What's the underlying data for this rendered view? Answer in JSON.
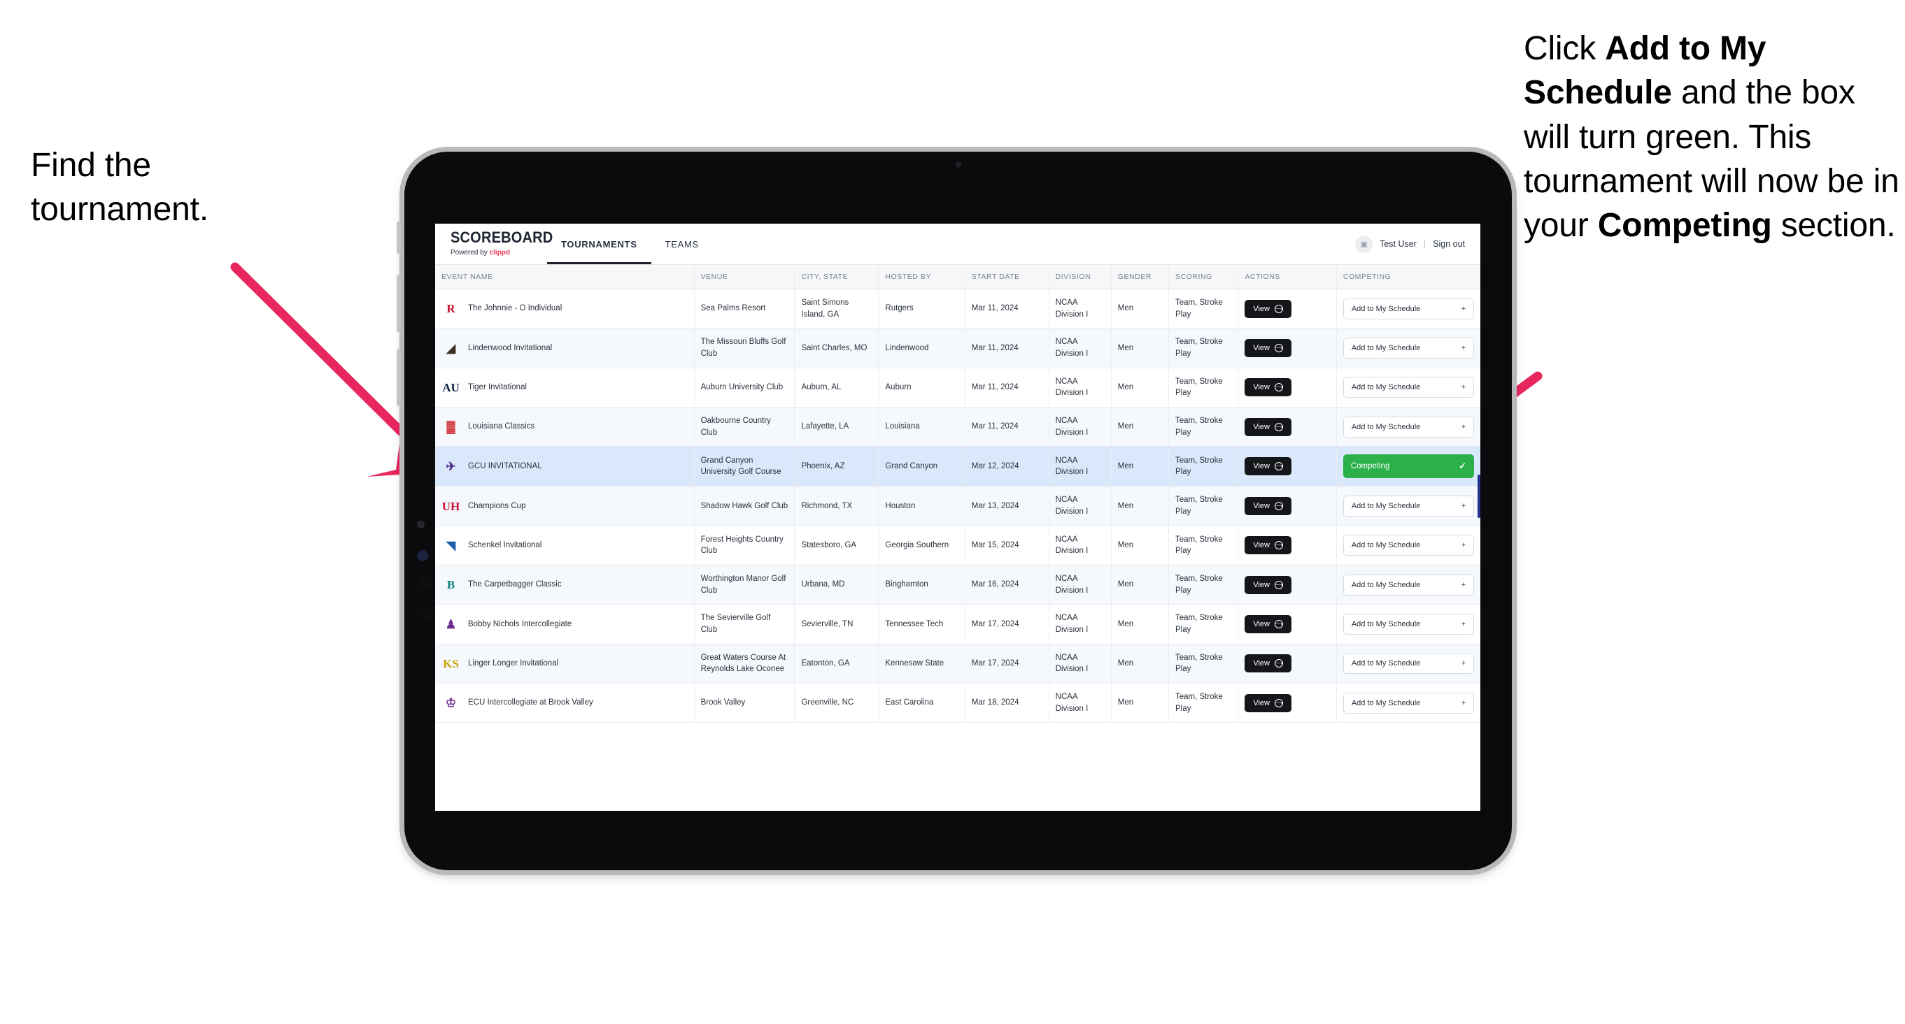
{
  "annotations": {
    "left": "Find the tournament.",
    "right_parts": [
      {
        "text": "Click ",
        "bold": false
      },
      {
        "text": "Add to My Schedule",
        "bold": true
      },
      {
        "text": " and the box will turn green. This tournament will now be in your ",
        "bold": false
      },
      {
        "text": "Competing",
        "bold": true
      },
      {
        "text": " section.",
        "bold": false
      }
    ],
    "arrow_color": "#e8275f"
  },
  "app": {
    "brand": {
      "title": "SCOREBOARD",
      "powered_prefix": "Powered by ",
      "powered_name": "clippd"
    },
    "nav_tabs": [
      {
        "label": "TOURNAMENTS",
        "active": true
      },
      {
        "label": "TEAMS",
        "active": false
      }
    ],
    "header_right": {
      "avatar_icon": "user-avatar-icon",
      "user_name": "Test User",
      "separator": "|",
      "sign_out": "Sign out"
    }
  },
  "table": {
    "columns": [
      "EVENT NAME",
      "VENUE",
      "CITY, STATE",
      "HOSTED BY",
      "START DATE",
      "DIVISION",
      "GENDER",
      "SCORING",
      "ACTIONS",
      "COMPETING"
    ],
    "action_label": "View",
    "add_label": "Add to My Schedule",
    "add_icon": "plus-icon",
    "competing_label": "Competing",
    "competing_icon": "check-icon",
    "competing_color": "#2bb04a",
    "rows": [
      {
        "logo": "R",
        "logo_color": "#c8102e",
        "logo_bg": "transparent",
        "event": "The Johnnie - O Individual",
        "venue": "Sea Palms Resort",
        "city": "Saint Simons Island, GA",
        "host": "Rutgers",
        "date": "Mar 11, 2024",
        "division": "NCAA Division I",
        "gender": "Men",
        "scoring": "Team, Stroke Play",
        "competing": false
      },
      {
        "logo": "◢",
        "logo_color": "#3b3226",
        "logo_bg": "transparent",
        "event": "Lindenwood Invitational",
        "venue": "The Missouri Bluffs Golf Club",
        "city": "Saint Charles, MO",
        "host": "Lindenwood",
        "date": "Mar 11, 2024",
        "division": "NCAA Division I",
        "gender": "Men",
        "scoring": "Team, Stroke Play",
        "competing": false
      },
      {
        "logo": "AU",
        "logo_color": "#0c2340",
        "logo_bg": "transparent",
        "event": "Tiger Invitational",
        "venue": "Auburn University Club",
        "city": "Auburn, AL",
        "host": "Auburn",
        "date": "Mar 11, 2024",
        "division": "NCAA Division I",
        "gender": "Men",
        "scoring": "Team, Stroke Play",
        "competing": false
      },
      {
        "logo": "▓",
        "logo_color": "#ce181e",
        "logo_bg": "transparent",
        "event": "Louisiana Classics",
        "venue": "Oakbourne Country Club",
        "city": "Lafayette, LA",
        "host": "Louisiana",
        "date": "Mar 11, 2024",
        "division": "NCAA Division I",
        "gender": "Men",
        "scoring": "Team, Stroke Play",
        "competing": false
      },
      {
        "logo": "✈",
        "logo_color": "#4f2d8f",
        "logo_bg": "transparent",
        "event": "GCU INVITATIONAL",
        "venue": "Grand Canyon University Golf Course",
        "city": "Phoenix, AZ",
        "host": "Grand Canyon",
        "date": "Mar 12, 2024",
        "division": "NCAA Division I",
        "gender": "Men",
        "scoring": "Team, Stroke Play",
        "competing": true,
        "highlight": true
      },
      {
        "logo": "UH",
        "logo_color": "#c8102e",
        "logo_bg": "transparent",
        "event": "Champions Cup",
        "venue": "Shadow Hawk Golf Club",
        "city": "Richmond, TX",
        "host": "Houston",
        "date": "Mar 13, 2024",
        "division": "NCAA Division I",
        "gender": "Men",
        "scoring": "Team, Stroke Play",
        "competing": false
      },
      {
        "logo": "◥",
        "logo_color": "#1e5fa8",
        "logo_bg": "transparent",
        "event": "Schenkel Invitational",
        "venue": "Forest Heights Country Club",
        "city": "Statesboro, GA",
        "host": "Georgia Southern",
        "date": "Mar 15, 2024",
        "division": "NCAA Division I",
        "gender": "Men",
        "scoring": "Team, Stroke Play",
        "competing": false
      },
      {
        "logo": "B",
        "logo_color": "#0f7f7f",
        "logo_bg": "transparent",
        "event": "The Carpetbagger Classic",
        "venue": "Worthington Manor Golf Club",
        "city": "Urbana, MD",
        "host": "Binghamton",
        "date": "Mar 16, 2024",
        "division": "NCAA Division I",
        "gender": "Men",
        "scoring": "Team, Stroke Play",
        "competing": false
      },
      {
        "logo": "♟",
        "logo_color": "#6b2d8f",
        "logo_bg": "transparent",
        "event": "Bobby Nichols Intercollegiate",
        "venue": "The Sevierville Golf Club",
        "city": "Sevierville, TN",
        "host": "Tennessee Tech",
        "date": "Mar 17, 2024",
        "division": "NCAA Division I",
        "gender": "Men",
        "scoring": "Team, Stroke Play",
        "competing": false
      },
      {
        "logo": "KS",
        "logo_color": "#c8a20a",
        "logo_bg": "transparent",
        "event": "Linger Longer Invitational",
        "venue": "Great Waters Course At Reynolds Lake Oconee",
        "city": "Eatonton, GA",
        "host": "Kennesaw State",
        "date": "Mar 17, 2024",
        "division": "NCAA Division I",
        "gender": "Men",
        "scoring": "Team, Stroke Play",
        "competing": false
      },
      {
        "logo": "♔",
        "logo_color": "#6b2d8f",
        "logo_bg": "transparent",
        "event": "ECU Intercollegiate at Brook Valley",
        "venue": "Brook Valley",
        "city": "Greenville, NC",
        "host": "East Carolina",
        "date": "Mar 18, 2024",
        "division": "NCAA Division I",
        "gender": "Men",
        "scoring": "Team, Stroke Play",
        "competing": false,
        "partial": true
      }
    ]
  }
}
